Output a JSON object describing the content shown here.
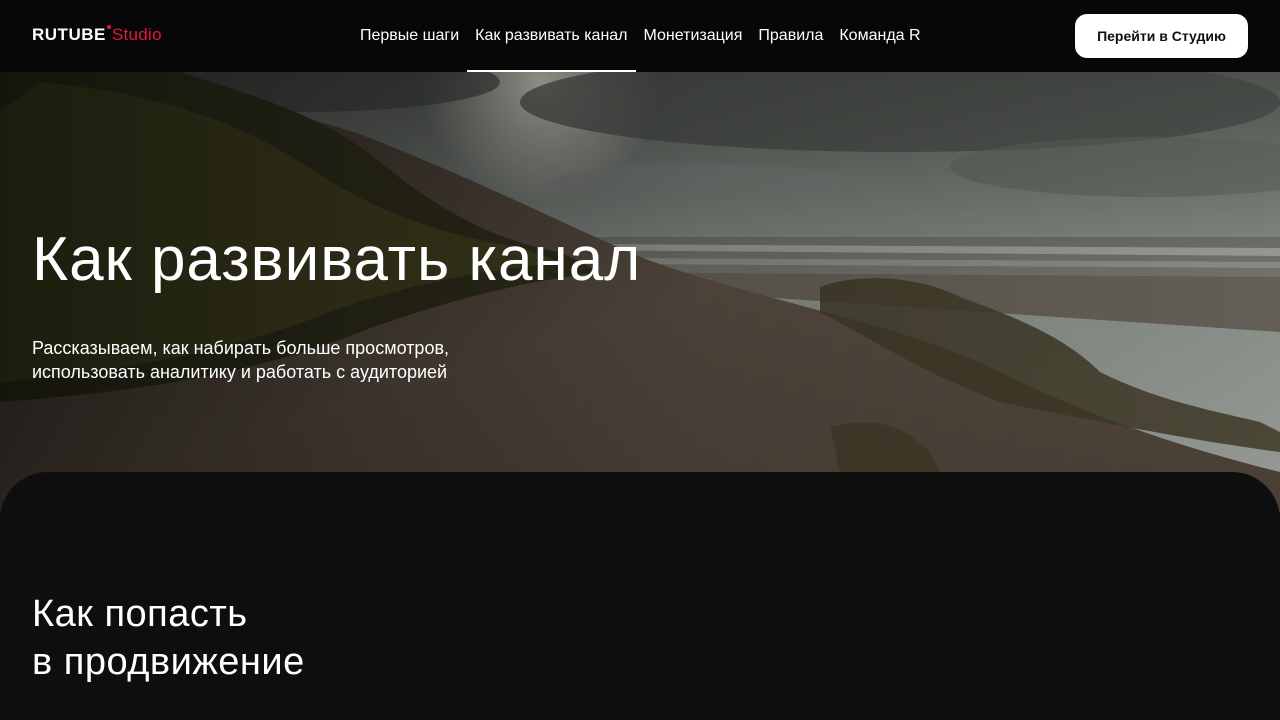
{
  "brand": {
    "logo_main": "RUTUBE",
    "logo_sub": "Studio",
    "accent_color": "#e5173f"
  },
  "nav": {
    "items": [
      {
        "label": "Первые шаги",
        "active": false
      },
      {
        "label": "Как развивать канал",
        "active": true
      },
      {
        "label": "Монетизация",
        "active": false
      },
      {
        "label": "Правила",
        "active": false
      },
      {
        "label": "Команда R",
        "active": false
      }
    ],
    "cta_label": "Перейти в Студию"
  },
  "hero": {
    "title": "Как развивать канал",
    "subtitle_line1": "Рассказываем, как набирать больше просмотров,",
    "subtitle_line2": "использовать аналитику и работать с аудиторией",
    "image": "beach-dunes-photo"
  },
  "section": {
    "title_line1": "Как попасть",
    "title_line2": "в продвижение"
  }
}
